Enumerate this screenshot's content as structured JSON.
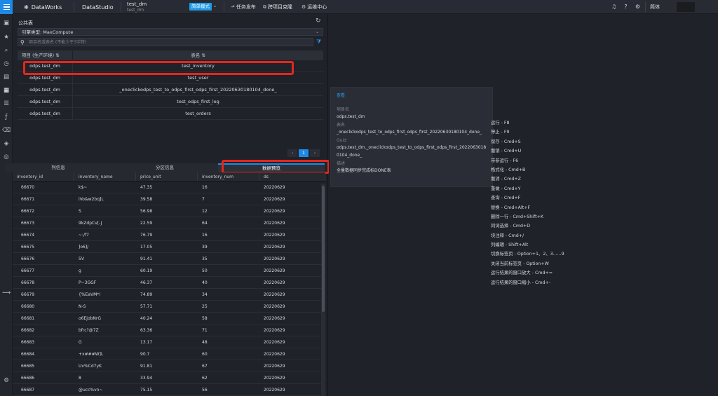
{
  "topbar": {
    "brand": "DataWorks",
    "product": "DataStudio",
    "workspace": "test_dm",
    "workspace_sub": "test_dm",
    "mode": "简单模式",
    "nav": [
      {
        "label": "任务发布",
        "icon": "publish-icon"
      },
      {
        "label": "跨项目克隆",
        "icon": "clone-icon"
      },
      {
        "label": "运维中心",
        "icon": "ops-icon"
      }
    ],
    "language": "简体"
  },
  "panel": {
    "title": "公共表",
    "engine_label": "引擎类型: MaxCompute",
    "search_placeholder": "项目名或表名 (不能少于3字符)",
    "table": {
      "headers": [
        "项目 (生产环境)",
        "表名"
      ],
      "rows": [
        [
          "odps.test_dm",
          "test_inventory"
        ],
        [
          "odps.test_dm",
          "test_user"
        ],
        [
          "odps.test_dm",
          "_oneclickodps_test_to_odps_first_odps_first_20220630180104_done_"
        ],
        [
          "odps.test_dm",
          "test_odps_first_log"
        ],
        [
          "odps.test_dm",
          "test_orders"
        ]
      ]
    },
    "pager": {
      "prev": "‹",
      "current": "1",
      "next": "›"
    },
    "tabs": [
      "列信息",
      "分区信息",
      "数据预览"
    ],
    "preview": {
      "headers": [
        "inventory_id",
        "inventory_name",
        "price_unit",
        "inventory_num",
        "ds"
      ],
      "rows": [
        [
          "66670",
          "k$~",
          "47.35",
          "16",
          "20220629"
        ],
        [
          "66671",
          "iVo&w2bq]L",
          "39.58",
          "7",
          "20220629"
        ],
        [
          "66672",
          "S",
          "56.98",
          "12",
          "20220629"
        ],
        [
          "66673",
          "9kZdpCv[-J",
          "22.59",
          "64",
          "20220629"
        ],
        [
          "66674",
          "~:/f7",
          "76.79",
          "16",
          "20220629"
        ],
        [
          "66675",
          "]o6]/",
          "17.05",
          "39",
          "20220629"
        ],
        [
          "66676",
          "5V",
          "91.41",
          "35",
          "20220629"
        ],
        [
          "66677",
          "g",
          "60.19",
          "50",
          "20220629"
        ],
        [
          "66678",
          "P~3GGF",
          "46.37",
          "40",
          "20220629"
        ],
        [
          "66679",
          "{%EaVM*!",
          "74.89",
          "34",
          "20220629"
        ],
        [
          "66680",
          "N-S",
          "57.71",
          "25",
          "20220629"
        ],
        [
          "66681",
          "o6EjobNrG",
          "40.24",
          "58",
          "20220629"
        ],
        [
          "66682",
          "bfrc?@7Z",
          "63.36",
          "71",
          "20220629"
        ],
        [
          "66683",
          "G",
          "13.17",
          "48",
          "20220629"
        ],
        [
          "66684",
          "+x###W]L",
          "90.7",
          "60",
          "20220629"
        ],
        [
          "66685",
          "Uv%Cd7yK",
          "91.81",
          "67",
          "20220629"
        ],
        [
          "66686",
          "8",
          "33.94",
          "62",
          "20220629"
        ],
        [
          "66687",
          "@ucc%vn~",
          "75.15",
          "56",
          "20220629"
        ]
      ]
    }
  },
  "tooltip": {
    "title": "查看",
    "project_label": "项目名",
    "project_value": "odps.test_dm",
    "table_label": "表名",
    "table_value": "_oneclickodps_test_to_odps_first_odps_first_20220630180104_done_",
    "guid_label": "Guid",
    "guid_value": "odps.test_dm._oneclickodps_test_to_odps_first_odps_first_20220630180104_done_",
    "desc_label": "描述",
    "desc_value": "全量数据同步完成标DONE表"
  },
  "shortcuts": [
    "运行 - F8",
    "停止 - F9",
    "保存 - Cmd+S",
    "撤销 - Cmd+U",
    "带参运行 - F6",
    "格式化 - Cmd+B",
    "撤消 - Cmd+Z",
    "重做 - Cmd+Y",
    "查询 - Cmd+F",
    "替换 - Cmd+Alt+F",
    "删除一行 - Cmd+Shift+K",
    "同词选择 - Cmd+D",
    "块注释 - Cmd+/",
    "列编辑 - Shift+Alt",
    "切换标签页 - Option+1、2、3......9",
    "关闭当前标签页 - Option+W",
    "运行结果的窗口放大 - Cmd+=",
    "运行结果的窗口缩小 - Cmd+-"
  ],
  "colors": {
    "accent": "#1e89e6",
    "highlight": "#e6261c",
    "background": "#1f2229"
  }
}
